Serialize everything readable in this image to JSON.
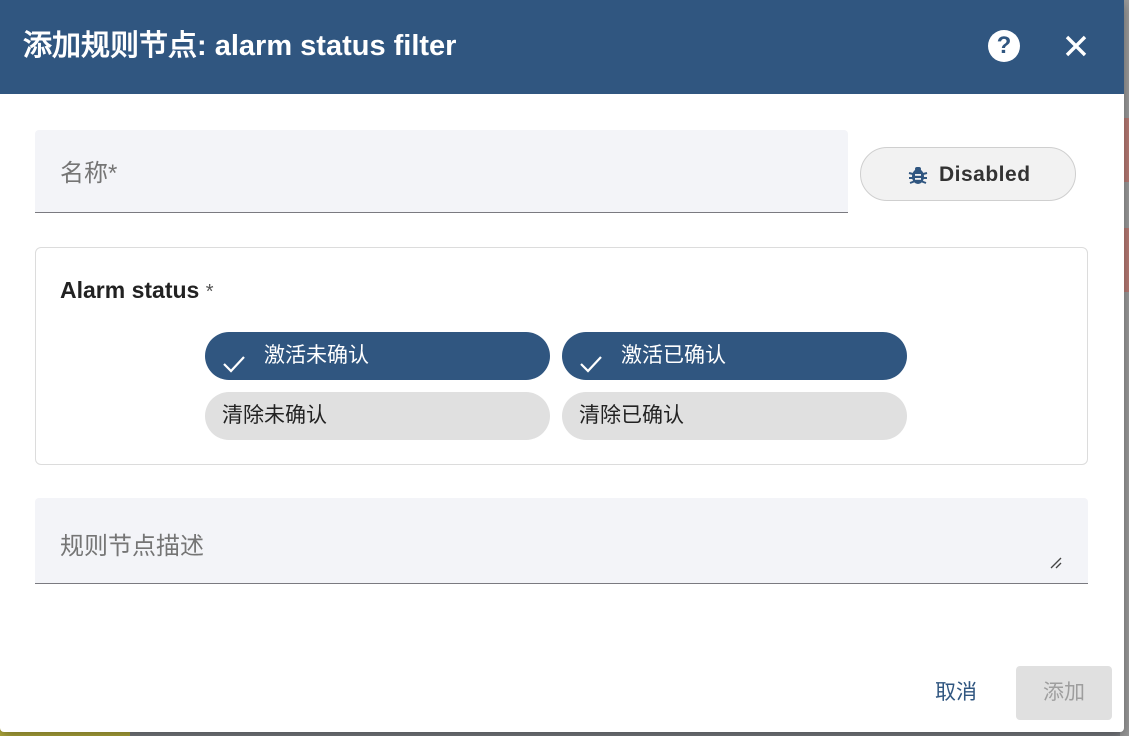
{
  "dialog": {
    "title": "添加规则节点: alarm status filter",
    "help_icon": "help-circle-icon",
    "close_icon": "close-icon"
  },
  "form": {
    "name": {
      "placeholder": "名称*",
      "value": ""
    },
    "debug": {
      "label": "Disabled",
      "icon": "bug-icon"
    },
    "alarm_status": {
      "title": "Alarm status",
      "required_mark": "*",
      "options": [
        {
          "label": "激活未确认",
          "selected": true
        },
        {
          "label": "激活已确认",
          "selected": true
        },
        {
          "label": "清除未确认",
          "selected": false
        },
        {
          "label": "清除已确认",
          "selected": false
        }
      ]
    },
    "description": {
      "placeholder": "规则节点描述",
      "value": ""
    }
  },
  "actions": {
    "cancel_label": "取消",
    "add_label": "添加",
    "add_enabled": false
  },
  "colors": {
    "primary": "#305680",
    "chip_unselected": "#e0e0e0",
    "field_background": "#f3f4f8",
    "disabled_button": "#e0e0e0"
  }
}
